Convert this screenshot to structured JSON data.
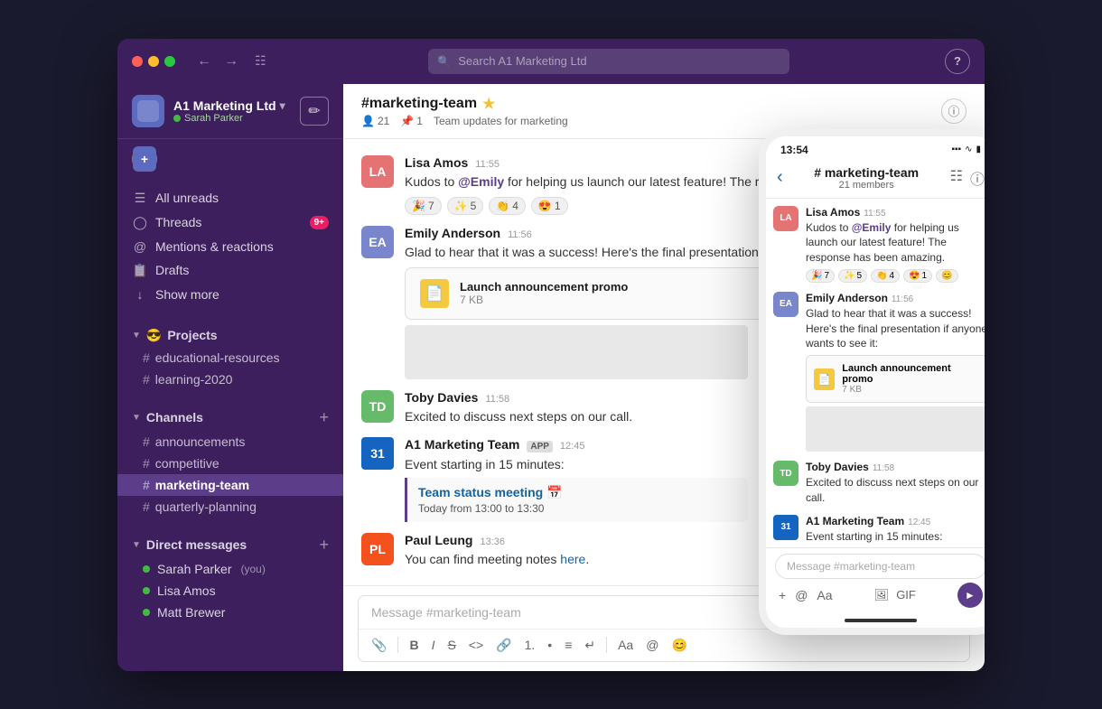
{
  "app": {
    "title": "A1 Marketing Ltd"
  },
  "titlebar": {
    "search_placeholder": "Search A1 Marketing Ltd",
    "help": "?"
  },
  "sidebar": {
    "workspace_name": "A1 Marketing Ltd",
    "workspace_chevron": "▾",
    "user_name": "Sarah Parker",
    "compose_icon": "✏",
    "add_icon": "+",
    "nav_items": [
      {
        "icon": "≡",
        "label": "All unreads",
        "badge": null
      },
      {
        "icon": "◎",
        "label": "Threads",
        "badge": "9+"
      },
      {
        "icon": "@",
        "label": "Mentions & reactions",
        "badge": null
      },
      {
        "icon": "📋",
        "label": "Drafts",
        "badge": null
      },
      {
        "icon": "↓",
        "label": "Show more",
        "badge": null
      }
    ],
    "sections": [
      {
        "name": "Projects",
        "emoji": "😎",
        "channels": [
          "educational-resources",
          "learning-2020"
        ]
      },
      {
        "name": "Channels",
        "channels": [
          "announcements",
          "competitive",
          "marketing-team",
          "quarterly-planning"
        ],
        "active": "marketing-team"
      }
    ],
    "direct_messages": {
      "label": "Direct messages",
      "add_icon": "+",
      "items": [
        {
          "name": "Sarah Parker",
          "suffix": "(you)",
          "online": true
        },
        {
          "name": "Lisa Amos",
          "online": true
        },
        {
          "name": "Matt Brewer",
          "online": true
        }
      ]
    }
  },
  "chat": {
    "channel_name": "#marketing-team",
    "channel_star": "★",
    "members_count": "21",
    "pins_count": "1",
    "topic": "Team updates for marketing",
    "messages": [
      {
        "author": "Lisa Amos",
        "time": "11:55",
        "avatar_color": "#e57373",
        "avatar_initials": "LA",
        "text": "Kudos to @Emily for helping us launch our latest feature! The response has been amazing.",
        "reactions": [
          {
            "emoji": "🎉",
            "count": "7"
          },
          {
            "emoji": "✨",
            "count": "5"
          },
          {
            "emoji": "👏",
            "count": "4"
          },
          {
            "emoji": "😍",
            "count": "1"
          }
        ]
      },
      {
        "author": "Emily Anderson",
        "time": "11:56",
        "avatar_color": "#7986cb",
        "avatar_initials": "EA",
        "text": "Glad to hear that it was a success! Here's the final presentation if anyone wants to see it:",
        "file": {
          "name": "Launch announcement promo",
          "size": "7 KB"
        }
      },
      {
        "author": "Toby Davies",
        "time": "11:58",
        "avatar_color": "#66bb6a",
        "avatar_initials": "TD",
        "text": "Excited to discuss next steps on our call."
      },
      {
        "author": "A1 Marketing Team",
        "time": "12:45",
        "is_app": true,
        "avatar_color": "#1565c0",
        "avatar_initials": "31",
        "text": "Event starting in 15 minutes:",
        "event": {
          "title": "Team status meeting 📅",
          "time": "Today from 13:00 to 13:30"
        }
      },
      {
        "author": "Paul Leung",
        "time": "13:36",
        "avatar_color": "#f4511e",
        "avatar_initials": "PL",
        "text_before": "You can find meeting notes ",
        "link": "here",
        "text_after": "."
      }
    ],
    "input_placeholder": "Message #marketing-team",
    "toolbar": [
      "📎",
      "B",
      "I",
      "S",
      "<>",
      "🔗",
      "1.",
      "•",
      "≡",
      "↩",
      "Aa",
      "@",
      "😊"
    ]
  },
  "mobile": {
    "time": "13:54",
    "channel_name": "# marketing-team",
    "member_count": "21 members",
    "input_placeholder": "Message #marketing-team"
  }
}
